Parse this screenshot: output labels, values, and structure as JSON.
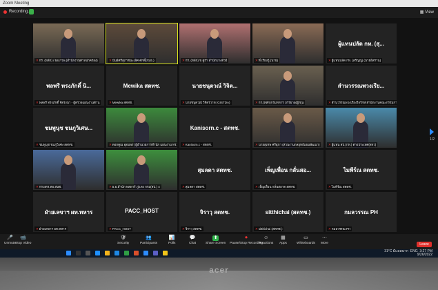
{
  "window": {
    "title": "Zoom Meeting",
    "recording_label": "Recording...",
    "view_label": "View",
    "page_indicator": "1/2"
  },
  "tiles": [
    {
      "name": "",
      "label": "กร. (หลัก) / ผอ.กวพ.(สำนักงานศาลปกครอง)",
      "type": "video"
    },
    {
      "name": "",
      "label": "นันธ์ศรีสุภาชนะเลิศ-ศักดิ์(กมธ.)",
      "type": "video"
    },
    {
      "name": "",
      "label": "กร. (หลัก) ข ตูรา สำนักบางตัวย์",
      "type": "video"
    },
    {
      "name": "",
      "label": "พี่ เรียงกู้ (นาย)",
      "type": "video"
    },
    {
      "name": "ผู้แทนปลัด กห. (สุ...",
      "label": "ผู้แทนปลัด กห. (สรัญญู) (นายอิสราน)",
      "type": "name"
    },
    {
      "name": "พลพรี ทรงภักดิ์ นิ...",
      "label": "พลพรี ทรงภักดิ์ จีดรงนา - ผู้ตรวจแผนงานด้าน",
      "type": "name"
    },
    {
      "name": "Mewika สตทช.",
      "label": "Mewika สตทช.",
      "type": "name"
    },
    {
      "name": "นายชนุตวณ์ วิจิต...",
      "label": "นายชนุตวณ์ วิจิตรวาท (GISTDA)",
      "type": "name"
    },
    {
      "name": "",
      "label": "กร.(หลัก)กรมทหาร ภรรยาอ(ผู้)ขุน",
      "type": "video"
    },
    {
      "name": "สำนวรรณพวงเรีย...",
      "label": "สำนวรรณพวงเรียงใจรักษ์ สำนักงานคณะกรรมการส่งเสริมวิ",
      "type": "name"
    },
    {
      "name": "ชมพูนุช ชมภูวิเศษ...",
      "label": "ชมพูนุช ชมภูวิเศษ สตทช.",
      "type": "name"
    },
    {
      "name": "",
      "label": "ดอกคูณ อุดมพร (ผู้อำนวยการสำนัก แผนงาน ทร.)",
      "type": "video"
    },
    {
      "name": "Kanisorn.c - สตทช.",
      "label": "Kanisorn.c - สตทช.",
      "type": "name"
    },
    {
      "name": "",
      "label": "นายสุเทพ ศรีสุภา (ส่วนงานกลยุทธ์แผนพัฒนา)",
      "type": "video"
    },
    {
      "name": "",
      "label": "ผู้แทน สป.(กห.) ต่างประเทศ(สจว)",
      "type": "video"
    },
    {
      "name": "",
      "label": "กร.ผตร.ทอ.สนช.",
      "type": "video"
    },
    {
      "name": "",
      "label": "ผ.อ.สำนัก พลพาร์ ภู่แดง กรม(สป.) 4",
      "type": "video"
    },
    {
      "name": "สุมลดา สตทช.",
      "label": "สุมลดา สตทช.",
      "type": "name"
    },
    {
      "name": "เพ็ญเพื่อน กลั่นสอ...",
      "label": "เพ็ญเพื่อน กลั่นสอาด สตทช.",
      "type": "name"
    },
    {
      "name": "ไมพีร์ณ สตทช.",
      "label": "ไมพีร์ณ สตทช.",
      "type": "name"
    },
    {
      "name": "ฝ่ายเลขาฯ ผท.ทหาร",
      "label": "ฝ่ายเลขาฯ ผท.ทหาร",
      "type": "name"
    },
    {
      "name": "PACC_HOST",
      "label": "PACC_HOST",
      "type": "name"
    },
    {
      "name": "จิราวุ สตทช.",
      "label": "จิราวุ สตทช.",
      "type": "name"
    },
    {
      "name": "sitthichai (สตทช.)",
      "label": "sitthichai (สตทช.)",
      "type": "name"
    },
    {
      "name": "กมลวรรณ PH",
      "label": "กมลวรรณ PH",
      "type": "name"
    }
  ],
  "toolbar": {
    "items": [
      {
        "label": "Unmute",
        "icon": "mic-icon"
      },
      {
        "label": "Stop Video",
        "icon": "video-icon"
      },
      {
        "label": "Security",
        "icon": "shield-icon"
      },
      {
        "label": "Participants",
        "icon": "participants-icon",
        "count": "22"
      },
      {
        "label": "Polls",
        "icon": "polls-icon"
      },
      {
        "label": "Chat",
        "icon": "chat-icon"
      },
      {
        "label": "Share Screen",
        "icon": "share-screen-icon"
      },
      {
        "label": "Pause/Stop Recording",
        "icon": "record-icon"
      },
      {
        "label": "Reactions",
        "icon": "reactions-icon"
      },
      {
        "label": "Apps",
        "icon": "apps-icon"
      },
      {
        "label": "Whiteboards",
        "icon": "whiteboard-icon"
      },
      {
        "label": "More",
        "icon": "more-icon"
      }
    ],
    "leave_label": "Leave"
  },
  "taskbar": {
    "weather": "31°C มีแดดมาก",
    "language": "ENG",
    "time": "3:27 PM",
    "date": "9/26/2022"
  },
  "monitor_brand": "acer"
}
